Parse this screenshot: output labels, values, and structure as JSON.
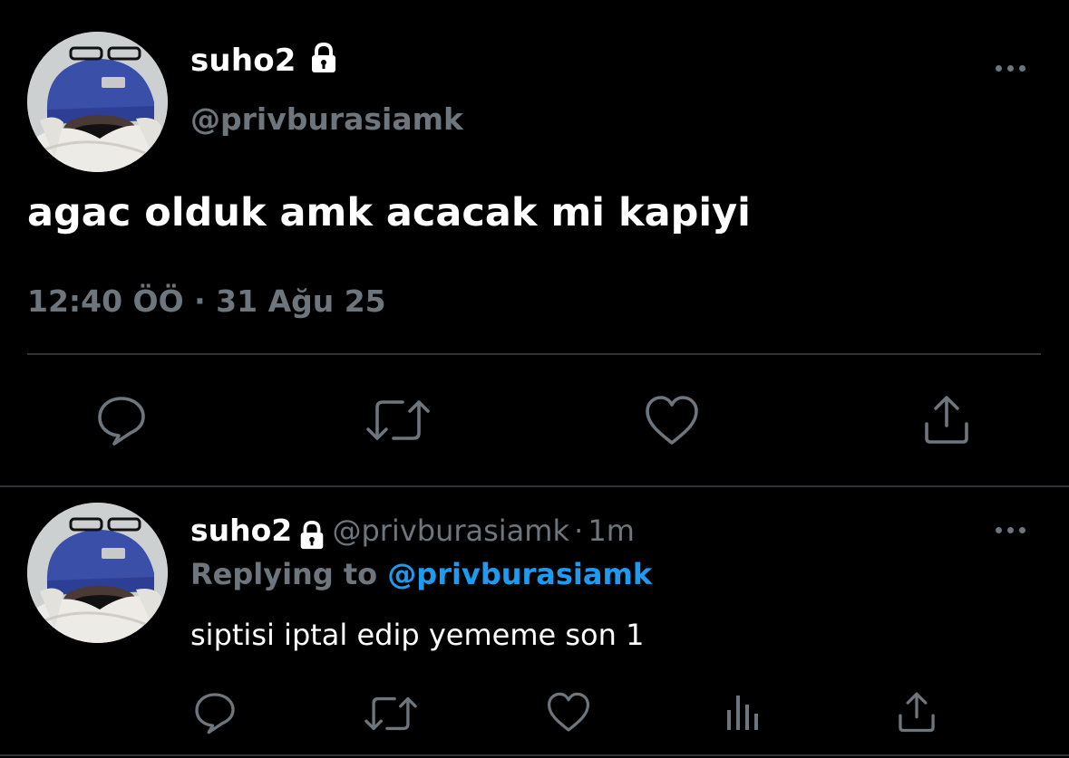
{
  "main_tweet": {
    "display_name": "suho2",
    "handle": "@privburasiamk",
    "text": "agac olduk amk acacak mi kapiyi",
    "timestamp": "12:40 ÖÖ · 31 Ağu 25",
    "actions": [
      "comment-icon",
      "retweet-icon",
      "heart-icon",
      "share-icon"
    ]
  },
  "reply_tweet": {
    "display_name": "suho2",
    "handle": "@privburasiamk",
    "separator": "·",
    "time_ago": "1m",
    "replying_prefix": "Replying to ",
    "replying_handle": "@privburasiamk",
    "text": "siptisi iptal edip yememe son 1",
    "actions": [
      "comment-icon",
      "retweet-icon",
      "heart-icon",
      "analytics-icon",
      "share-icon"
    ]
  },
  "colors": {
    "background": "#000000",
    "primary_text": "#ffffff",
    "secondary_text": "#6e767d",
    "link": "#1d9bf0",
    "divider": "#2f3336"
  }
}
